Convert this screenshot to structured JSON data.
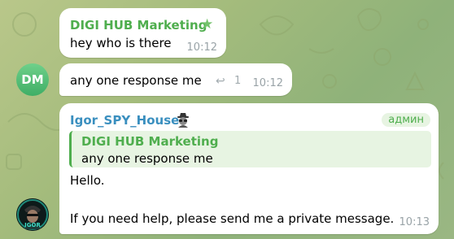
{
  "colors": {
    "accent_green": "#4fae4e",
    "sender_blue": "#3a8fbf",
    "time_gray": "#99a3a7",
    "quote_bg": "#e7f4e2",
    "avatar_green": "#3fae66"
  },
  "messages": [
    {
      "sender": "DIGI HUB Marketing",
      "sender_icon": "star-icon",
      "text": "hey who is there",
      "time": "10:12"
    },
    {
      "avatar_initials": "DM",
      "text": "any one response me",
      "reply_icon": "reply-arrow-icon",
      "reply_count": "1",
      "time": "10:12"
    },
    {
      "sender": "Igor_SPY_House",
      "sender_icon": "spy-icon",
      "badge": "админ",
      "quote": {
        "sender": "DIGI HUB Marketing",
        "text": "any one response me"
      },
      "line1": "Hello.",
      "line2": "If you need help, please send me a private message.",
      "time": "10:13",
      "avatar_icon": "igor-avatar-icon",
      "avatar_label": "IGOR"
    }
  ]
}
